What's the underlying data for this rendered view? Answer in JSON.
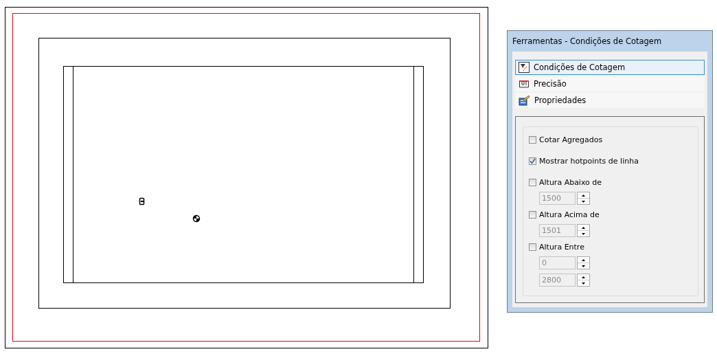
{
  "panel": {
    "title": "Ferramentas - Condições de Cotagem",
    "sections": [
      {
        "label": "Condições de Cotagem",
        "selected": true
      },
      {
        "label": "Precisão",
        "selected": false
      },
      {
        "label": "Propriedades",
        "selected": false
      }
    ],
    "options": [
      {
        "label": "Cotar Agregados",
        "checked": false
      },
      {
        "label": "Mostrar hotpoints de linha",
        "checked": true
      },
      {
        "label": "Altura Abaixo de",
        "checked": false,
        "fields": [
          {
            "value": "1500",
            "disabled": true
          }
        ]
      },
      {
        "label": "Altura Acima de",
        "checked": false,
        "fields": [
          {
            "value": "1501",
            "disabled": true
          }
        ]
      },
      {
        "label": "Altura Entre",
        "checked": false,
        "fields": [
          {
            "value": "0",
            "disabled": true
          },
          {
            "value": "2800",
            "disabled": true
          }
        ]
      }
    ]
  }
}
